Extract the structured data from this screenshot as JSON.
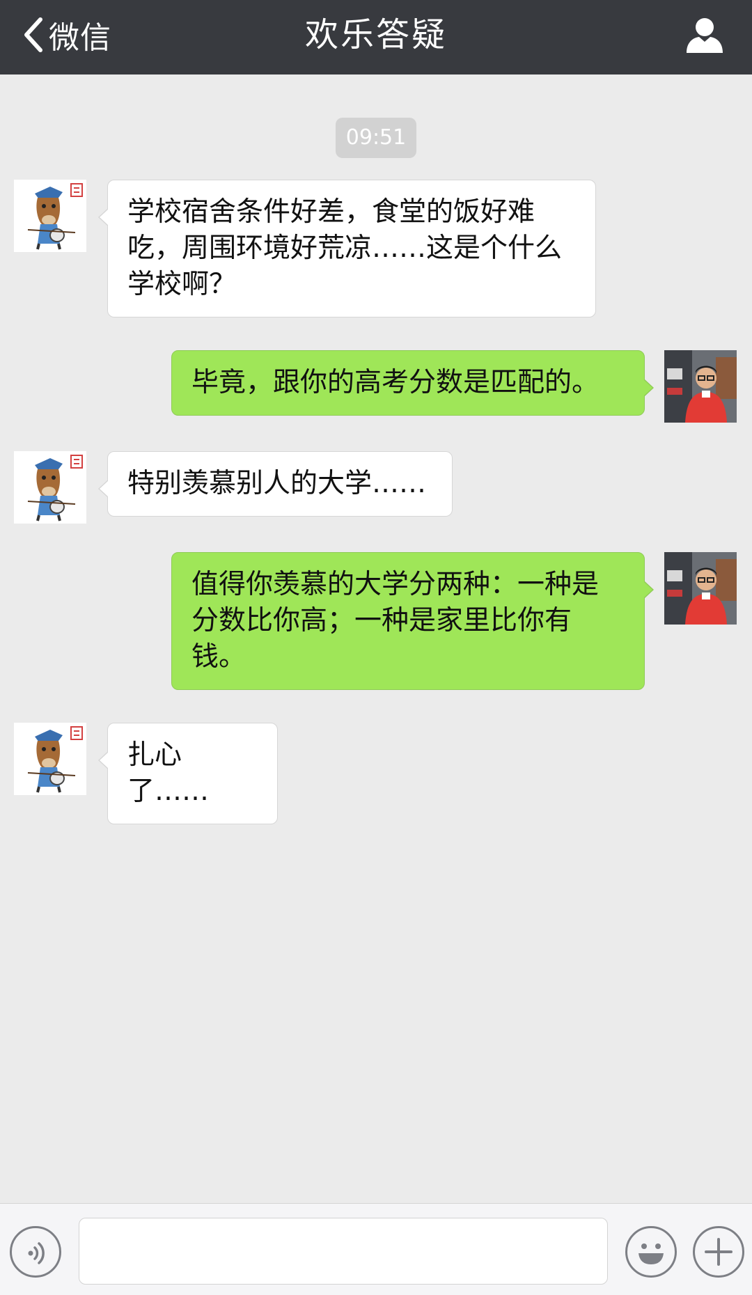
{
  "header": {
    "back_label": "微信",
    "title": "欢乐答疑"
  },
  "chat": {
    "timestamp": "09:51",
    "messages": [
      {
        "side": "left",
        "text": "学校宿舍条件好差，食堂的饭好难吃，周围环境好荒凉……这是个什么学校啊？"
      },
      {
        "side": "right",
        "text": "毕竟，跟你的高考分数是匹配的。"
      },
      {
        "side": "left",
        "text": "特别羡慕别人的大学……"
      },
      {
        "side": "right",
        "text": "值得你羡慕的大学分两种：一种是分数比你高；一种是家里比你有钱。"
      },
      {
        "side": "left",
        "text": "扎心了……"
      }
    ]
  },
  "input": {
    "value": "",
    "placeholder": ""
  },
  "icons": {
    "back": "chevron-left-icon",
    "profile": "user-icon",
    "voice": "voice-icon",
    "emoji": "smiley-icon",
    "plus": "plus-icon"
  },
  "colors": {
    "header_bg": "#383a3f",
    "chat_bg": "#ebebeb",
    "outgoing_bubble": "#9fe658",
    "incoming_bubble": "#ffffff",
    "timestamp_bg": "#d2d2d2"
  }
}
